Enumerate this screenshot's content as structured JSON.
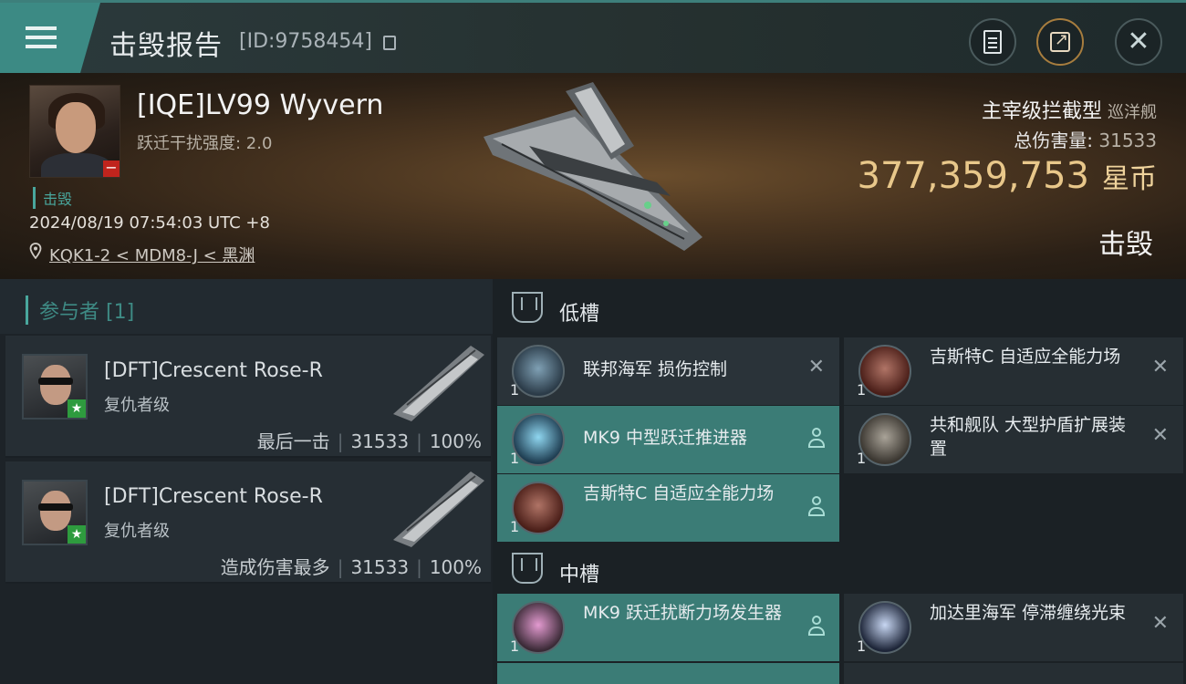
{
  "header": {
    "title": "击毁报告",
    "kill_id": "[ID:9758454]"
  },
  "victim": {
    "pilot": "[IQE]LV99 Wyvern",
    "warp_strength": "跃迁干扰强度: 2.0",
    "destroyed_tag": "击毁",
    "timestamp": "2024/08/19 07:54:03 UTC +8",
    "location": "KQK1-2 < MDM8-J < 黑渊",
    "ship_class": "主宰级拦截型",
    "ship_type": "巡洋舰",
    "total_damage_label": "总伤害量:",
    "total_damage": "31533",
    "isk_value": "377,359,753",
    "isk_unit": "星币",
    "status": "击毁"
  },
  "participants": {
    "title": "参与者 [1]",
    "rows": [
      {
        "name": "[DFT]Crescent Rose-R",
        "ship": "复仇者级",
        "role": "最后一击",
        "damage": "31533",
        "percent": "100%"
      },
      {
        "name": "[DFT]Crescent Rose-R",
        "ship": "复仇者级",
        "role": "造成伤害最多",
        "damage": "31533",
        "percent": "100%"
      }
    ]
  },
  "fittings": {
    "low_label": "低槽",
    "mid_label": "中槽",
    "low": [
      {
        "name": "联邦海军 损伤控制",
        "qty": "1",
        "state": "destroyed"
      },
      {
        "name": "吉斯特C 自适应全能力场",
        "qty": "1",
        "state": "destroyed"
      },
      {
        "name": "MK9 中型跃迁推进器",
        "qty": "1",
        "state": "dropped"
      },
      {
        "name": "共和舰队 大型护盾扩展装置",
        "qty": "1",
        "state": "destroyed"
      },
      {
        "name": "吉斯特C 自适应全能力场",
        "qty": "1",
        "state": "dropped"
      }
    ],
    "mid": [
      {
        "name": "MK9 跃迁扰断力场发生器",
        "qty": "1",
        "state": "dropped"
      },
      {
        "name": "加达里海军 停滞缠绕光束",
        "qty": "1",
        "state": "destroyed"
      }
    ]
  },
  "colors": {
    "accent": "#3c8a84",
    "isk_gold": "#e8c78a",
    "active_row": "#3b7c76"
  }
}
